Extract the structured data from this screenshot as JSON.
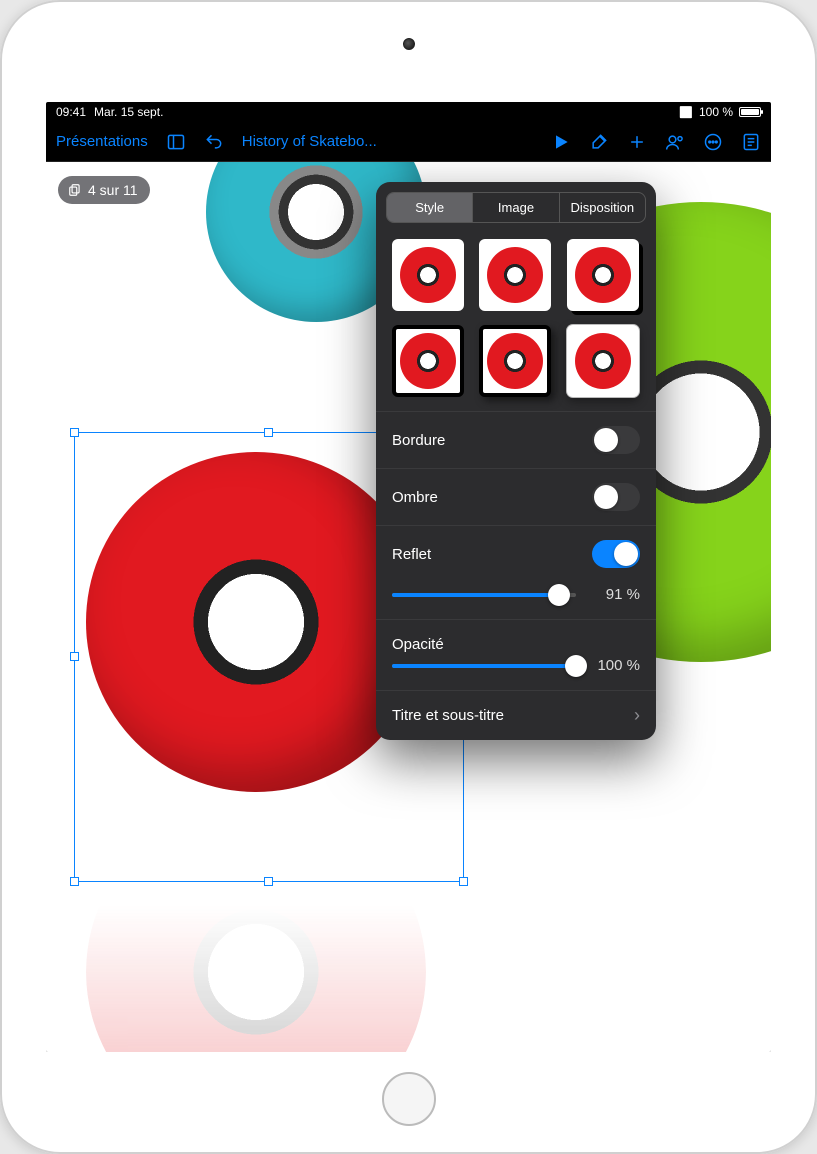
{
  "status": {
    "time": "09:41",
    "date": "Mar. 15 sept.",
    "battery_pct": "100 %"
  },
  "toolbar": {
    "back_label": "Présentations",
    "title": "History of Skatebo..."
  },
  "slide_indicator": {
    "text": "4 sur 11"
  },
  "popover": {
    "tabs": {
      "style": "Style",
      "image": "Image",
      "layout": "Disposition"
    },
    "border_label": "Bordure",
    "border_on": false,
    "shadow_label": "Ombre",
    "shadow_on": false,
    "reflection_label": "Reflet",
    "reflection_on": true,
    "reflection_pct": 91,
    "reflection_pct_text": "91 %",
    "opacity_label": "Opacité",
    "opacity_pct": 100,
    "opacity_pct_text": "100 %",
    "title_subtitle_label": "Titre et sous-titre"
  }
}
